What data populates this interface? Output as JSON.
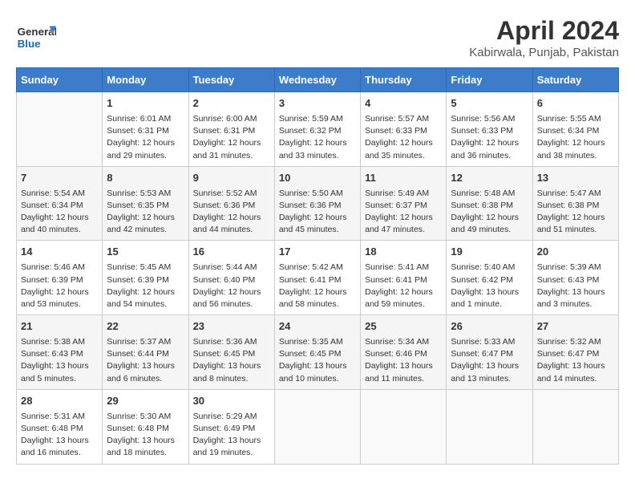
{
  "logo": {
    "line1": "General",
    "line2": "Blue"
  },
  "title": "April 2024",
  "subtitle": "Kabirwala, Punjab, Pakistan",
  "headers": [
    "Sunday",
    "Monday",
    "Tuesday",
    "Wednesday",
    "Thursday",
    "Friday",
    "Saturday"
  ],
  "weeks": [
    [
      {
        "num": "",
        "info": ""
      },
      {
        "num": "1",
        "info": "Sunrise: 6:01 AM\nSunset: 6:31 PM\nDaylight: 12 hours\nand 29 minutes."
      },
      {
        "num": "2",
        "info": "Sunrise: 6:00 AM\nSunset: 6:31 PM\nDaylight: 12 hours\nand 31 minutes."
      },
      {
        "num": "3",
        "info": "Sunrise: 5:59 AM\nSunset: 6:32 PM\nDaylight: 12 hours\nand 33 minutes."
      },
      {
        "num": "4",
        "info": "Sunrise: 5:57 AM\nSunset: 6:33 PM\nDaylight: 12 hours\nand 35 minutes."
      },
      {
        "num": "5",
        "info": "Sunrise: 5:56 AM\nSunset: 6:33 PM\nDaylight: 12 hours\nand 36 minutes."
      },
      {
        "num": "6",
        "info": "Sunrise: 5:55 AM\nSunset: 6:34 PM\nDaylight: 12 hours\nand 38 minutes."
      }
    ],
    [
      {
        "num": "7",
        "info": "Sunrise: 5:54 AM\nSunset: 6:34 PM\nDaylight: 12 hours\nand 40 minutes."
      },
      {
        "num": "8",
        "info": "Sunrise: 5:53 AM\nSunset: 6:35 PM\nDaylight: 12 hours\nand 42 minutes."
      },
      {
        "num": "9",
        "info": "Sunrise: 5:52 AM\nSunset: 6:36 PM\nDaylight: 12 hours\nand 44 minutes."
      },
      {
        "num": "10",
        "info": "Sunrise: 5:50 AM\nSunset: 6:36 PM\nDaylight: 12 hours\nand 45 minutes."
      },
      {
        "num": "11",
        "info": "Sunrise: 5:49 AM\nSunset: 6:37 PM\nDaylight: 12 hours\nand 47 minutes."
      },
      {
        "num": "12",
        "info": "Sunrise: 5:48 AM\nSunset: 6:38 PM\nDaylight: 12 hours\nand 49 minutes."
      },
      {
        "num": "13",
        "info": "Sunrise: 5:47 AM\nSunset: 6:38 PM\nDaylight: 12 hours\nand 51 minutes."
      }
    ],
    [
      {
        "num": "14",
        "info": "Sunrise: 5:46 AM\nSunset: 6:39 PM\nDaylight: 12 hours\nand 53 minutes."
      },
      {
        "num": "15",
        "info": "Sunrise: 5:45 AM\nSunset: 6:39 PM\nDaylight: 12 hours\nand 54 minutes."
      },
      {
        "num": "16",
        "info": "Sunrise: 5:44 AM\nSunset: 6:40 PM\nDaylight: 12 hours\nand 56 minutes."
      },
      {
        "num": "17",
        "info": "Sunrise: 5:42 AM\nSunset: 6:41 PM\nDaylight: 12 hours\nand 58 minutes."
      },
      {
        "num": "18",
        "info": "Sunrise: 5:41 AM\nSunset: 6:41 PM\nDaylight: 12 hours\nand 59 minutes."
      },
      {
        "num": "19",
        "info": "Sunrise: 5:40 AM\nSunset: 6:42 PM\nDaylight: 13 hours\nand 1 minute."
      },
      {
        "num": "20",
        "info": "Sunrise: 5:39 AM\nSunset: 6:43 PM\nDaylight: 13 hours\nand 3 minutes."
      }
    ],
    [
      {
        "num": "21",
        "info": "Sunrise: 5:38 AM\nSunset: 6:43 PM\nDaylight: 13 hours\nand 5 minutes."
      },
      {
        "num": "22",
        "info": "Sunrise: 5:37 AM\nSunset: 6:44 PM\nDaylight: 13 hours\nand 6 minutes."
      },
      {
        "num": "23",
        "info": "Sunrise: 5:36 AM\nSunset: 6:45 PM\nDaylight: 13 hours\nand 8 minutes."
      },
      {
        "num": "24",
        "info": "Sunrise: 5:35 AM\nSunset: 6:45 PM\nDaylight: 13 hours\nand 10 minutes."
      },
      {
        "num": "25",
        "info": "Sunrise: 5:34 AM\nSunset: 6:46 PM\nDaylight: 13 hours\nand 11 minutes."
      },
      {
        "num": "26",
        "info": "Sunrise: 5:33 AM\nSunset: 6:47 PM\nDaylight: 13 hours\nand 13 minutes."
      },
      {
        "num": "27",
        "info": "Sunrise: 5:32 AM\nSunset: 6:47 PM\nDaylight: 13 hours\nand 14 minutes."
      }
    ],
    [
      {
        "num": "28",
        "info": "Sunrise: 5:31 AM\nSunset: 6:48 PM\nDaylight: 13 hours\nand 16 minutes."
      },
      {
        "num": "29",
        "info": "Sunrise: 5:30 AM\nSunset: 6:48 PM\nDaylight: 13 hours\nand 18 minutes."
      },
      {
        "num": "30",
        "info": "Sunrise: 5:29 AM\nSunset: 6:49 PM\nDaylight: 13 hours\nand 19 minutes."
      },
      {
        "num": "",
        "info": ""
      },
      {
        "num": "",
        "info": ""
      },
      {
        "num": "",
        "info": ""
      },
      {
        "num": "",
        "info": ""
      }
    ]
  ]
}
